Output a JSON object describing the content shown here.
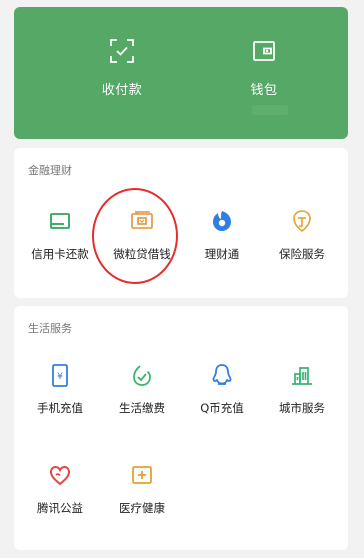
{
  "header": {
    "items": [
      {
        "label": "收付款",
        "icon": "scan-pay-icon"
      },
      {
        "label": "钱包",
        "icon": "wallet-icon"
      }
    ]
  },
  "finance": {
    "title": "金融理财",
    "items": [
      {
        "label": "信用卡还款",
        "icon": "credit-card-icon",
        "color": "#2ea35a"
      },
      {
        "label": "微粒贷借钱",
        "icon": "loan-icon",
        "color": "#e0923a"
      },
      {
        "label": "理财通",
        "icon": "licaitong-icon",
        "color": "#2f7fde"
      },
      {
        "label": "保险服务",
        "icon": "insurance-icon",
        "color": "#e7a030"
      }
    ]
  },
  "life": {
    "title": "生活服务",
    "items": [
      {
        "label": "手机充值",
        "icon": "phone-topup-icon",
        "color": "#2f7fde"
      },
      {
        "label": "生活缴费",
        "icon": "utilities-icon",
        "color": "#3cb371"
      },
      {
        "label": "Q币充值",
        "icon": "qcoin-icon",
        "color": "#2f7fde"
      },
      {
        "label": "城市服务",
        "icon": "city-service-icon",
        "color": "#3cb371"
      },
      {
        "label": "腾讯公益",
        "icon": "charity-icon",
        "color": "#e64545"
      },
      {
        "label": "医疗健康",
        "icon": "health-icon",
        "color": "#e7a030"
      }
    ]
  },
  "colors": {
    "header_green": "#55a866",
    "annotation_red": "#e52d2d"
  }
}
